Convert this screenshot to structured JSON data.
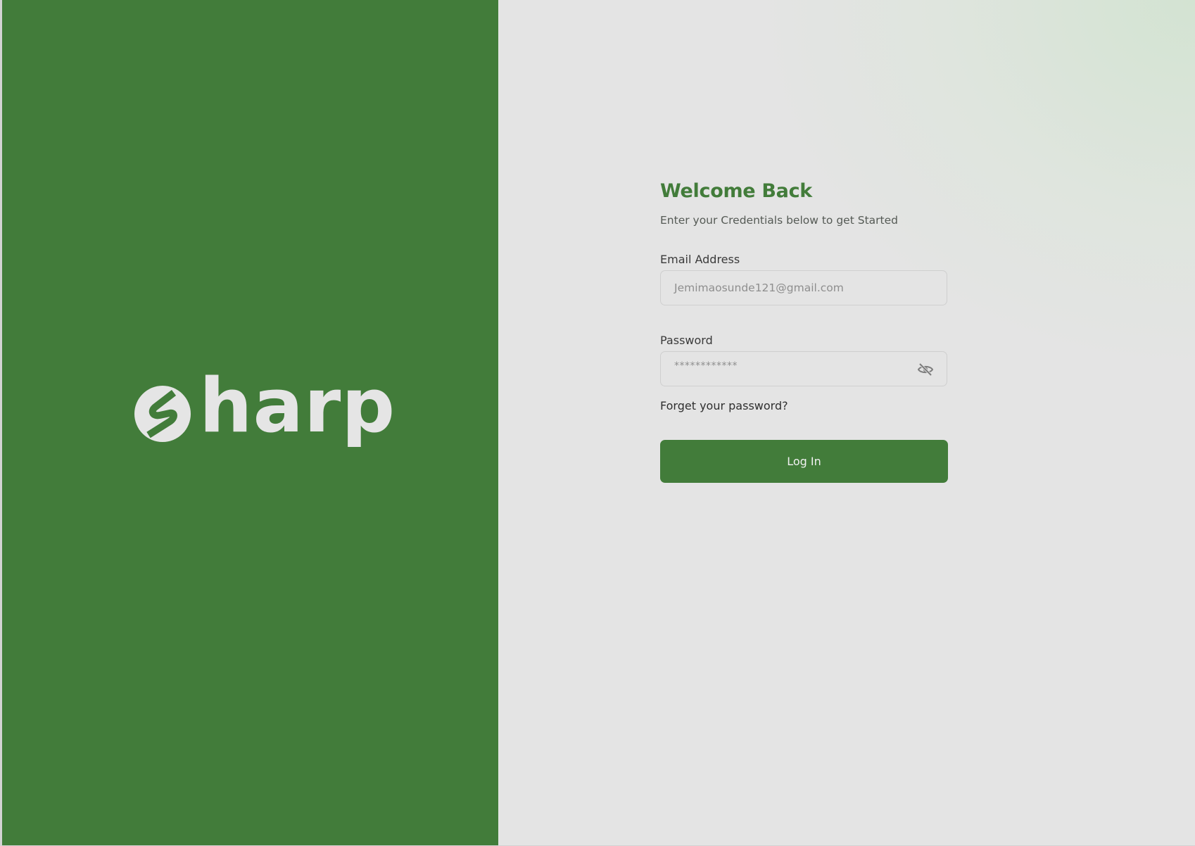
{
  "brand": {
    "name": "harp",
    "primary_color": "#427c3a",
    "logo_icon": "sharp-s-logo-icon"
  },
  "login": {
    "title": "Welcome Back",
    "subtitle": "Enter your Credentials below to get Started",
    "email": {
      "label": "Email Address",
      "value": "Jemimaosunde121@gmail.com"
    },
    "password": {
      "label": "Password",
      "value": "************",
      "toggle_icon": "eye-off-icon"
    },
    "forgot_label": "Forget your password?",
    "submit_label": "Log In"
  }
}
